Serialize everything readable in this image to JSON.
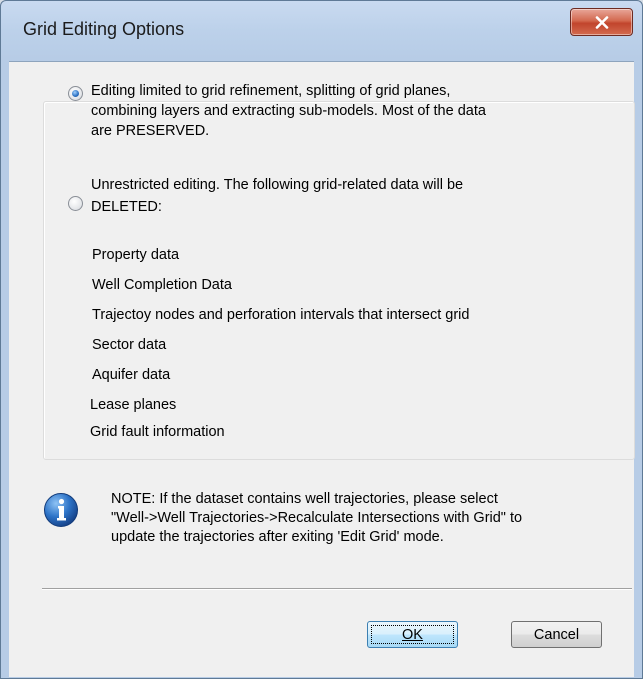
{
  "window": {
    "title": "Grid Editing Options"
  },
  "options": [
    {
      "selected": true,
      "lines": [
        "Editing limited to grid refinement, splitting of grid planes,",
        "combining layers and extracting sub-models. Most of the data",
        "are PRESERVED."
      ]
    },
    {
      "selected": false,
      "lines": [
        "Unrestricted editing. The following grid-related data will be",
        "DELETED:"
      ]
    }
  ],
  "deleted_items": [
    "Property data",
    "Well Completion Data",
    "Trajectoy nodes and perforation intervals that intersect grid",
    "Sector data",
    "Aquifer data",
    "Lease planes",
    "Grid fault information"
  ],
  "note": {
    "icon": "info-icon",
    "lines": [
      "NOTE:  If the dataset contains well trajectories, please select",
      "\"Well->Well Trajectories->Recalculate Intersections with Grid\" to",
      "update the trajectories after exiting 'Edit Grid' mode."
    ]
  },
  "buttons": {
    "ok_label": "OK",
    "cancel_label": "Cancel"
  },
  "colors": {
    "title_bar": "#bcd1ea",
    "close_button": "#c1452d",
    "dialog_background": "#f0f0f0",
    "ok_button_border": "#3c7fb1",
    "info_icon": "#1d5db0"
  }
}
